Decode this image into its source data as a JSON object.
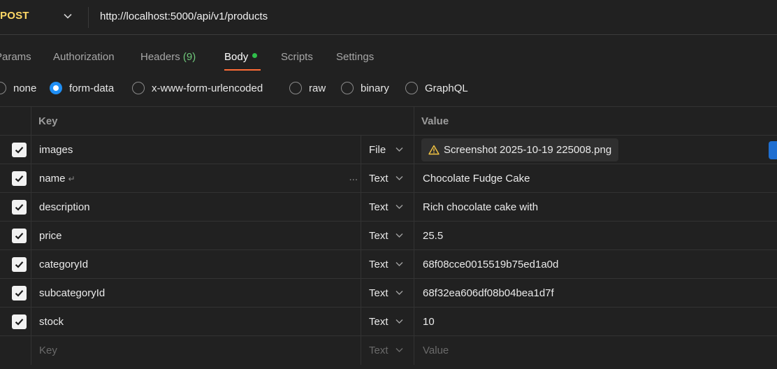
{
  "request": {
    "method": "POST",
    "url": "http://localhost:5000/api/v1/products"
  },
  "tabs": [
    {
      "label": "Params"
    },
    {
      "label": "Authorization"
    },
    {
      "label": "Headers",
      "count": "(9)"
    },
    {
      "label": "Body",
      "active": true
    },
    {
      "label": "Scripts"
    },
    {
      "label": "Settings"
    }
  ],
  "body_types": [
    {
      "label": "none",
      "checked": false
    },
    {
      "label": "form-data",
      "checked": true
    },
    {
      "label": "x-www-form-urlencoded",
      "checked": false
    },
    {
      "label": "raw",
      "checked": false
    },
    {
      "label": "binary",
      "checked": false
    },
    {
      "label": "GraphQL",
      "checked": false
    }
  ],
  "table": {
    "headers": {
      "key": "Key",
      "value": "Value"
    },
    "rows": [
      {
        "key": "images",
        "type": "File",
        "value": "Screenshot 2025-10-19 225008.png",
        "checked": true
      },
      {
        "key": "name",
        "type": "Text",
        "value": "Chocolate Fudge Cake",
        "checked": true
      },
      {
        "key": "description",
        "type": "Text",
        "value": "Rich chocolate cake with",
        "checked": true
      },
      {
        "key": "price",
        "type": "Text",
        "value": "25.5",
        "checked": true
      },
      {
        "key": "categoryId",
        "type": "Text",
        "value": "68f08cce0015519b75ed1a0d",
        "checked": true
      },
      {
        "key": "subcategoryId",
        "type": "Text",
        "value": "68f32ea606df08b04bea1d7f",
        "checked": true
      },
      {
        "key": "stock",
        "type": "Text",
        "value": "10",
        "checked": true
      }
    ],
    "empty_row": {
      "key_placeholder": "Key",
      "type": "Text",
      "value_placeholder": "Value"
    }
  },
  "icons": {
    "multiline": "↵",
    "more": "..."
  },
  "colors": {
    "method": "#ffd866",
    "active_tab_underline": "#ff6c37",
    "body_dot": "#2fbf4a",
    "headers_count": "#6fc77a",
    "radio_checked": "#1f8ff5",
    "file_warning": "#f5c542"
  }
}
